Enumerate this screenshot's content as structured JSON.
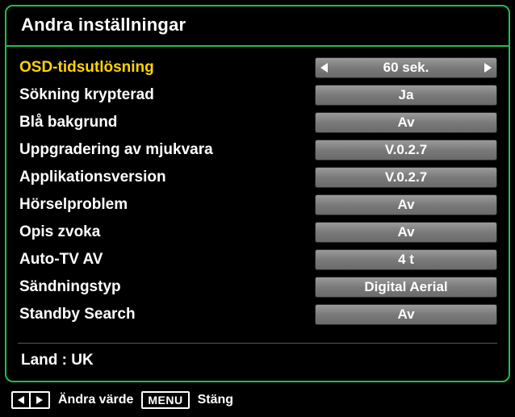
{
  "title": "Andra inställningar",
  "rows": [
    {
      "label": "OSD-tidsutlösning",
      "value": "60 sek.",
      "active": true
    },
    {
      "label": "Sökning krypterad",
      "value": "Ja",
      "active": false
    },
    {
      "label": "Blå bakgrund",
      "value": "Av",
      "active": false
    },
    {
      "label": "Uppgradering av mjukvara",
      "value": "V.0.2.7",
      "active": false
    },
    {
      "label": "Applikationsversion",
      "value": "V.0.2.7",
      "active": false
    },
    {
      "label": "Hörselproblem",
      "value": "Av",
      "active": false
    },
    {
      "label": "Opis zvoka",
      "value": "Av",
      "active": false
    },
    {
      "label": "Auto-TV AV",
      "value": "4 t",
      "active": false
    },
    {
      "label": "Sändningstyp",
      "value": "Digital Aerial",
      "active": false
    },
    {
      "label": "Standby Search",
      "value": "Av",
      "active": false
    }
  ],
  "country_label": "Land : UK",
  "footer": {
    "change_value": "Ändra värde",
    "menu_key": "MENU",
    "close": "Stäng"
  }
}
